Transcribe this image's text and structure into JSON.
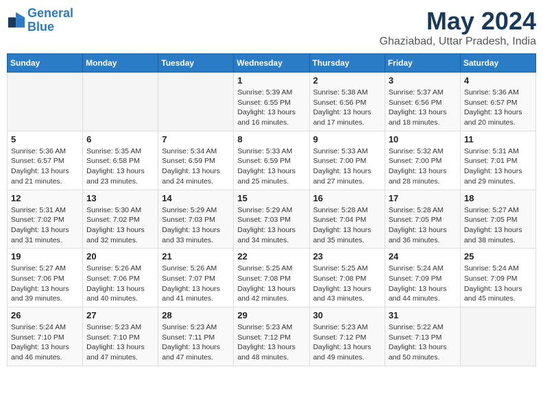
{
  "header": {
    "logo_line1": "General",
    "logo_line2": "Blue",
    "month_title": "May 2024",
    "subtitle": "Ghaziabad, Uttar Pradesh, India"
  },
  "days_of_week": [
    "Sunday",
    "Monday",
    "Tuesday",
    "Wednesday",
    "Thursday",
    "Friday",
    "Saturday"
  ],
  "weeks": [
    [
      {
        "day": "",
        "info": []
      },
      {
        "day": "",
        "info": []
      },
      {
        "day": "",
        "info": []
      },
      {
        "day": "1",
        "info": [
          "Sunrise: 5:39 AM",
          "Sunset: 6:55 PM",
          "Daylight: 13 hours",
          "and 16 minutes."
        ]
      },
      {
        "day": "2",
        "info": [
          "Sunrise: 5:38 AM",
          "Sunset: 6:56 PM",
          "Daylight: 13 hours",
          "and 17 minutes."
        ]
      },
      {
        "day": "3",
        "info": [
          "Sunrise: 5:37 AM",
          "Sunset: 6:56 PM",
          "Daylight: 13 hours",
          "and 18 minutes."
        ]
      },
      {
        "day": "4",
        "info": [
          "Sunrise: 5:36 AM",
          "Sunset: 6:57 PM",
          "Daylight: 13 hours",
          "and 20 minutes."
        ]
      }
    ],
    [
      {
        "day": "5",
        "info": [
          "Sunrise: 5:36 AM",
          "Sunset: 6:57 PM",
          "Daylight: 13 hours",
          "and 21 minutes."
        ]
      },
      {
        "day": "6",
        "info": [
          "Sunrise: 5:35 AM",
          "Sunset: 6:58 PM",
          "Daylight: 13 hours",
          "and 23 minutes."
        ]
      },
      {
        "day": "7",
        "info": [
          "Sunrise: 5:34 AM",
          "Sunset: 6:59 PM",
          "Daylight: 13 hours",
          "and 24 minutes."
        ]
      },
      {
        "day": "8",
        "info": [
          "Sunrise: 5:33 AM",
          "Sunset: 6:59 PM",
          "Daylight: 13 hours",
          "and 25 minutes."
        ]
      },
      {
        "day": "9",
        "info": [
          "Sunrise: 5:33 AM",
          "Sunset: 7:00 PM",
          "Daylight: 13 hours",
          "and 27 minutes."
        ]
      },
      {
        "day": "10",
        "info": [
          "Sunrise: 5:32 AM",
          "Sunset: 7:00 PM",
          "Daylight: 13 hours",
          "and 28 minutes."
        ]
      },
      {
        "day": "11",
        "info": [
          "Sunrise: 5:31 AM",
          "Sunset: 7:01 PM",
          "Daylight: 13 hours",
          "and 29 minutes."
        ]
      }
    ],
    [
      {
        "day": "12",
        "info": [
          "Sunrise: 5:31 AM",
          "Sunset: 7:02 PM",
          "Daylight: 13 hours",
          "and 31 minutes."
        ]
      },
      {
        "day": "13",
        "info": [
          "Sunrise: 5:30 AM",
          "Sunset: 7:02 PM",
          "Daylight: 13 hours",
          "and 32 minutes."
        ]
      },
      {
        "day": "14",
        "info": [
          "Sunrise: 5:29 AM",
          "Sunset: 7:03 PM",
          "Daylight: 13 hours",
          "and 33 minutes."
        ]
      },
      {
        "day": "15",
        "info": [
          "Sunrise: 5:29 AM",
          "Sunset: 7:03 PM",
          "Daylight: 13 hours",
          "and 34 minutes."
        ]
      },
      {
        "day": "16",
        "info": [
          "Sunrise: 5:28 AM",
          "Sunset: 7:04 PM",
          "Daylight: 13 hours",
          "and 35 minutes."
        ]
      },
      {
        "day": "17",
        "info": [
          "Sunrise: 5:28 AM",
          "Sunset: 7:05 PM",
          "Daylight: 13 hours",
          "and 36 minutes."
        ]
      },
      {
        "day": "18",
        "info": [
          "Sunrise: 5:27 AM",
          "Sunset: 7:05 PM",
          "Daylight: 13 hours",
          "and 38 minutes."
        ]
      }
    ],
    [
      {
        "day": "19",
        "info": [
          "Sunrise: 5:27 AM",
          "Sunset: 7:06 PM",
          "Daylight: 13 hours",
          "and 39 minutes."
        ]
      },
      {
        "day": "20",
        "info": [
          "Sunrise: 5:26 AM",
          "Sunset: 7:06 PM",
          "Daylight: 13 hours",
          "and 40 minutes."
        ]
      },
      {
        "day": "21",
        "info": [
          "Sunrise: 5:26 AM",
          "Sunset: 7:07 PM",
          "Daylight: 13 hours",
          "and 41 minutes."
        ]
      },
      {
        "day": "22",
        "info": [
          "Sunrise: 5:25 AM",
          "Sunset: 7:08 PM",
          "Daylight: 13 hours",
          "and 42 minutes."
        ]
      },
      {
        "day": "23",
        "info": [
          "Sunrise: 5:25 AM",
          "Sunset: 7:08 PM",
          "Daylight: 13 hours",
          "and 43 minutes."
        ]
      },
      {
        "day": "24",
        "info": [
          "Sunrise: 5:24 AM",
          "Sunset: 7:09 PM",
          "Daylight: 13 hours",
          "and 44 minutes."
        ]
      },
      {
        "day": "25",
        "info": [
          "Sunrise: 5:24 AM",
          "Sunset: 7:09 PM",
          "Daylight: 13 hours",
          "and 45 minutes."
        ]
      }
    ],
    [
      {
        "day": "26",
        "info": [
          "Sunrise: 5:24 AM",
          "Sunset: 7:10 PM",
          "Daylight: 13 hours",
          "and 46 minutes."
        ]
      },
      {
        "day": "27",
        "info": [
          "Sunrise: 5:23 AM",
          "Sunset: 7:10 PM",
          "Daylight: 13 hours",
          "and 47 minutes."
        ]
      },
      {
        "day": "28",
        "info": [
          "Sunrise: 5:23 AM",
          "Sunset: 7:11 PM",
          "Daylight: 13 hours",
          "and 47 minutes."
        ]
      },
      {
        "day": "29",
        "info": [
          "Sunrise: 5:23 AM",
          "Sunset: 7:12 PM",
          "Daylight: 13 hours",
          "and 48 minutes."
        ]
      },
      {
        "day": "30",
        "info": [
          "Sunrise: 5:23 AM",
          "Sunset: 7:12 PM",
          "Daylight: 13 hours",
          "and 49 minutes."
        ]
      },
      {
        "day": "31",
        "info": [
          "Sunrise: 5:22 AM",
          "Sunset: 7:13 PM",
          "Daylight: 13 hours",
          "and 50 minutes."
        ]
      },
      {
        "day": "",
        "info": []
      }
    ]
  ]
}
